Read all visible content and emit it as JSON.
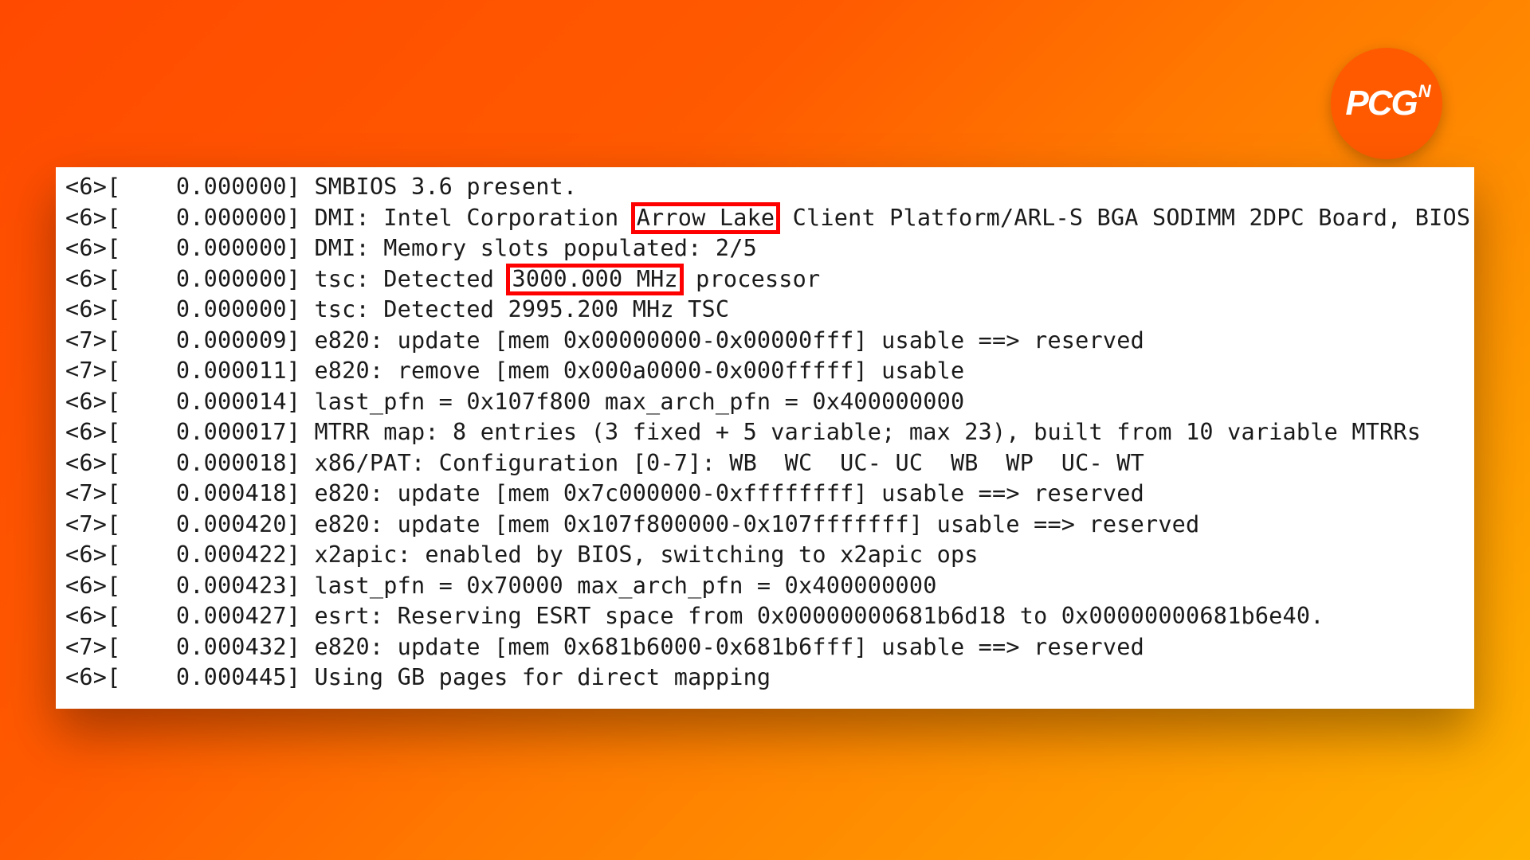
{
  "badge": {
    "main": "PCG",
    "sup": "N"
  },
  "highlight": {
    "arrow_lake": "Arrow Lake",
    "mhz": "3000.000 MHz"
  },
  "lines": [
    {
      "level": "6",
      "ts": "0.000000",
      "pre": "SMBIOS 3.6 present."
    },
    {
      "level": "6",
      "ts": "0.000000",
      "pre": "DMI: Intel Corporation ",
      "hl": "arrow_lake",
      "post": " Client Platform/ARL-S BGA SODIMM 2DPC Board, BIOS"
    },
    {
      "level": "6",
      "ts": "0.000000",
      "pre": "DMI: Memory slots populated: 2/5"
    },
    {
      "level": "6",
      "ts": "0.000000",
      "pre": "tsc: Detected ",
      "hl": "mhz",
      "post": " processor"
    },
    {
      "level": "6",
      "ts": "0.000000",
      "pre": "tsc: Detected 2995.200 MHz TSC"
    },
    {
      "level": "7",
      "ts": "0.000009",
      "pre": "e820: update [mem 0x00000000-0x00000fff] usable ==> reserved"
    },
    {
      "level": "7",
      "ts": "0.000011",
      "pre": "e820: remove [mem 0x000a0000-0x000fffff] usable"
    },
    {
      "level": "6",
      "ts": "0.000014",
      "pre": "last_pfn = 0x107f800 max_arch_pfn = 0x400000000"
    },
    {
      "level": "6",
      "ts": "0.000017",
      "pre": "MTRR map: 8 entries (3 fixed + 5 variable; max 23), built from 10 variable MTRRs"
    },
    {
      "level": "6",
      "ts": "0.000018",
      "pre": "x86/PAT: Configuration [0-7]: WB  WC  UC- UC  WB  WP  UC- WT"
    },
    {
      "level": "7",
      "ts": "0.000418",
      "pre": "e820: update [mem 0x7c000000-0xffffffff] usable ==> reserved"
    },
    {
      "level": "7",
      "ts": "0.000420",
      "pre": "e820: update [mem 0x107f800000-0x107fffffff] usable ==> reserved"
    },
    {
      "level": "6",
      "ts": "0.000422",
      "pre": "x2apic: enabled by BIOS, switching to x2apic ops"
    },
    {
      "level": "6",
      "ts": "0.000423",
      "pre": "last_pfn = 0x70000 max_arch_pfn = 0x400000000"
    },
    {
      "level": "6",
      "ts": "0.000427",
      "pre": "esrt: Reserving ESRT space from 0x00000000681b6d18 to 0x00000000681b6e40."
    },
    {
      "level": "7",
      "ts": "0.000432",
      "pre": "e820: update [mem 0x681b6000-0x681b6fff] usable ==> reserved"
    },
    {
      "level": "6",
      "ts": "0.000445",
      "pre": "Using GB pages for direct mapping"
    }
  ]
}
